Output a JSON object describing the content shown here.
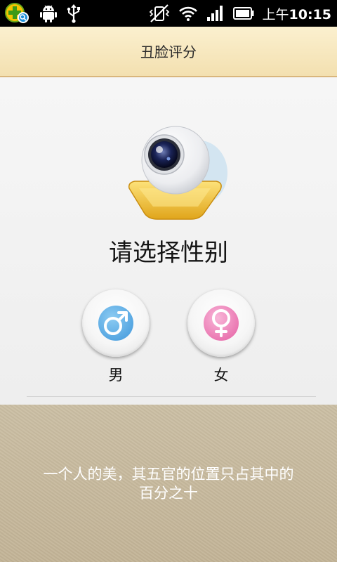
{
  "status_bar": {
    "time_prefix": "上午",
    "time": "10:15",
    "icons": [
      "app-plus-search-icon",
      "android-icon",
      "usb-icon",
      "vibrate-muted-icon",
      "wifi-icon",
      "signal-icon",
      "battery-icon"
    ]
  },
  "app": {
    "title": "丑脸评分"
  },
  "main": {
    "prompt": "请选择性别",
    "male_label": "男",
    "female_label": "女"
  },
  "footer": {
    "quote_line1": "一个人的美，其五官的位置只占其中的",
    "quote_line2": "百分之十"
  },
  "colors": {
    "title_bar_bg": "#f6e6bc",
    "title_bar_border": "#d9b67c",
    "male_blue": "#4a9fde",
    "female_pink": "#ea6aab",
    "camera_gold": "#f2c230",
    "quote_bg": "#c7b99d"
  }
}
